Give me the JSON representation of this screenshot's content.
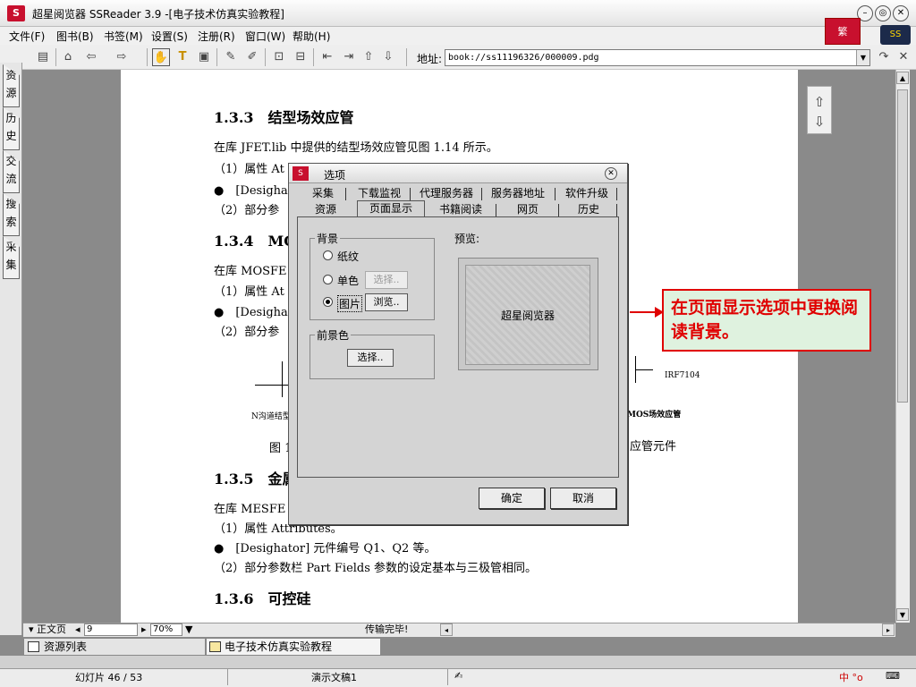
{
  "window": {
    "title": "超星阅览器 SSReader 3.9 -[电子技术仿真实验教程]",
    "brand_badge": "繁",
    "globe_label": "SS"
  },
  "menu": [
    "文件(F)",
    "图书(B)",
    "书签(M)",
    "设置(S)",
    "注册(R)",
    "窗口(W)",
    "帮助(H)"
  ],
  "toolbar": {
    "address_label": "地址:",
    "address_value": "book://ss11196326/000009.pdg"
  },
  "side_tabs": [
    "资源",
    "历史",
    "交流",
    "搜索",
    "采集"
  ],
  "document": {
    "sections": [
      {
        "heading": "1.3.3　结型场效应管"
      },
      {
        "heading": "1.3.4　MOS"
      },
      {
        "heading": "1.3.5　金属"
      },
      {
        "heading": "1.3.6　可控硅"
      }
    ],
    "lines": [
      "在库 JFET.lib 中提供的结型场效应管见图 1.14 所示。",
      "（1）属性 At",
      "●　[Desigha",
      "（2）部分参",
      "在库 MOSFE",
      "（1）属性 At",
      "●　[Desigha",
      "（2）部分参",
      "在库 MESFE",
      "（1）属性 Attributes。",
      "●　[Desighator]  元件编号 Q1、Q2 等。",
      "（2）部分参数栏 Part Fields 参数的设定基本与三极管相同。"
    ],
    "fig_labels": {
      "left_caption": "N沟道结型",
      "fig_number": "图 1",
      "right_part": "IRF7104",
      "right_caption": "MOS场效应管",
      "right_tail": "应管元件"
    }
  },
  "dialog": {
    "title": "选项",
    "tabs_row1": [
      "采集",
      "下载监视",
      "代理服务器",
      "服务器地址",
      "软件升级"
    ],
    "tabs_row2": [
      "资源",
      "页面显示",
      "书籍阅读",
      "网页",
      "历史"
    ],
    "active_tab": "页面显示",
    "background_group": {
      "label": "背景",
      "options": [
        {
          "label": "纸纹",
          "selected": false
        },
        {
          "label": "单色",
          "selected": false,
          "button": "选择.."
        },
        {
          "label": "图片",
          "selected": true,
          "button": "浏览.."
        }
      ]
    },
    "foreground_group": {
      "label": "前景色",
      "button": "选择.."
    },
    "preview_label": "预览:",
    "preview_text": "超星阅览器",
    "ok": "确定",
    "cancel": "取消"
  },
  "callout": {
    "text": "在页面显示选项中更换阅读背景。",
    "color": "#e00000"
  },
  "statusbar": {
    "page_type": "正文页",
    "page_number": "9",
    "zoom": "70%",
    "status": "传输完毕!"
  },
  "bottom_tabs": {
    "resource_list": "资源列表",
    "book_tab": "电子技术仿真实验教程"
  },
  "taskbar": {
    "slide": "幻灯片 46 / 53",
    "doc": "演示文稿1",
    "tray": "中 °o"
  }
}
